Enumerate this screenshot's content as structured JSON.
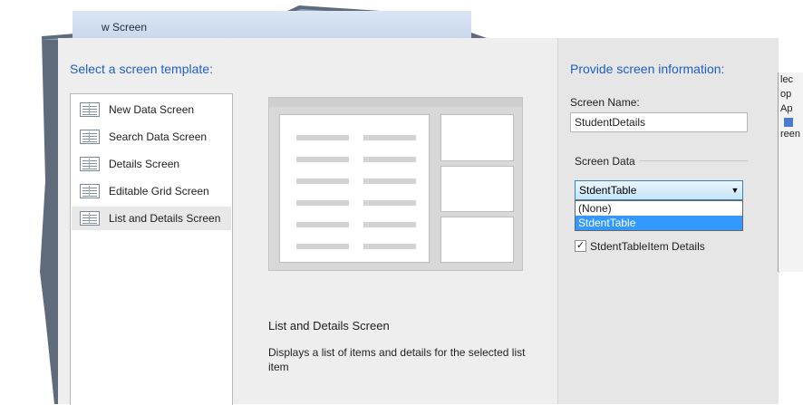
{
  "window": {
    "title": "w Screen"
  },
  "templates": {
    "heading": "Select a screen template:",
    "items": [
      {
        "label": "New Data Screen"
      },
      {
        "label": "Search Data Screen"
      },
      {
        "label": "Details Screen"
      },
      {
        "label": "Editable Grid Screen"
      },
      {
        "label": "List and Details Screen",
        "selected": true
      }
    ]
  },
  "description": {
    "title": "List and Details Screen",
    "text": "Displays a list of items and details for the selected list item"
  },
  "screen_info": {
    "heading": "Provide screen information:",
    "name_label": "Screen Name:",
    "name_value": "StudentDetails",
    "data_group_label": "Screen Data",
    "data_selected": "StdentTable",
    "data_options": [
      "(None)",
      "StdentTable"
    ],
    "details_checkbox_label": "StdentTableItem Details",
    "details_checked": true
  },
  "background_window": {
    "fragments": [
      "lec",
      "op",
      "Ap",
      "reen"
    ]
  },
  "colors": {
    "heading_blue": "#1f5fbf",
    "selection_blue": "#3399ff",
    "pane_gray": "#eeeeef"
  }
}
